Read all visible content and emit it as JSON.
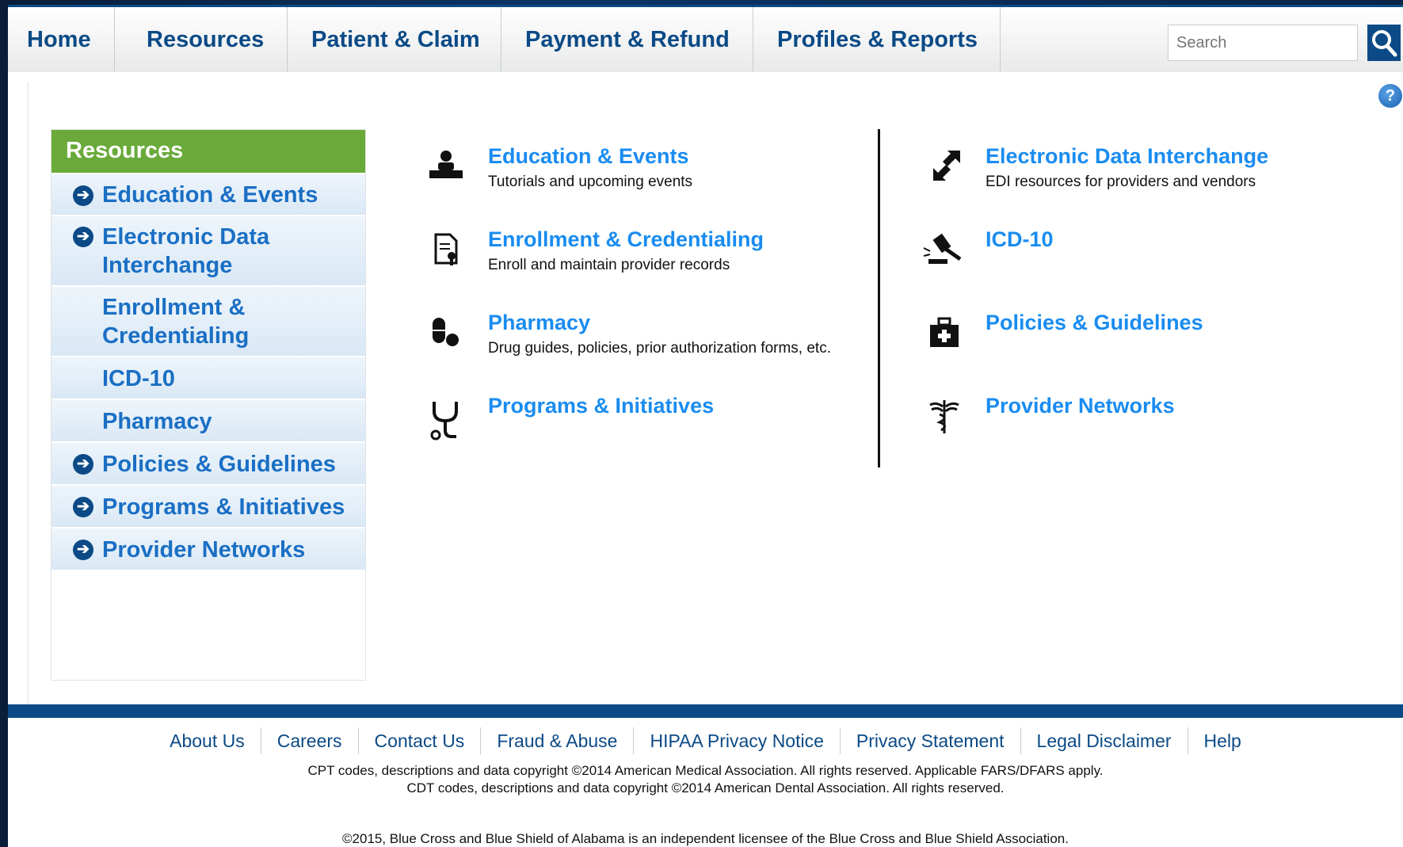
{
  "nav": {
    "items": [
      "Home",
      "Resources",
      "Patient & Claim",
      "Payment & Refund",
      "Profiles & Reports"
    ],
    "search_placeholder": "Search"
  },
  "sidebar": {
    "title": "Resources",
    "items": [
      {
        "label": "Education & Events",
        "arrow": true
      },
      {
        "label": "Electronic Data Interchange",
        "arrow": true
      },
      {
        "label": "Enrollment & Credentialing",
        "arrow": false
      },
      {
        "label": "ICD-10",
        "arrow": false
      },
      {
        "label": "Pharmacy",
        "arrow": false
      },
      {
        "label": "Policies & Guidelines",
        "arrow": true
      },
      {
        "label": "Programs & Initiatives",
        "arrow": true
      },
      {
        "label": "Provider Networks",
        "arrow": true
      }
    ]
  },
  "resources": {
    "left": [
      {
        "title": "Education & Events",
        "desc": "Tutorials and upcoming events",
        "icon": "teacher-icon"
      },
      {
        "title": "Enrollment & Credentialing",
        "desc": "Enroll and maintain provider records",
        "icon": "certificate-icon"
      },
      {
        "title": "Pharmacy",
        "desc": "Drug guides, policies, prior authorization forms, etc.",
        "icon": "pills-icon"
      },
      {
        "title": "Programs & Initiatives",
        "desc": "",
        "icon": "stethoscope-icon"
      }
    ],
    "right": [
      {
        "title": "Electronic Data Interchange",
        "desc": "EDI resources for providers and vendors",
        "icon": "exchange-arrows-icon"
      },
      {
        "title": "ICD-10",
        "desc": "",
        "icon": "gavel-icon"
      },
      {
        "title": "Policies & Guidelines",
        "desc": "",
        "icon": "medical-kit-icon"
      },
      {
        "title": "Provider Networks",
        "desc": "",
        "icon": "caduceus-icon"
      }
    ]
  },
  "footer": {
    "links": [
      "About Us",
      "Careers",
      "Contact Us",
      "Fraud & Abuse",
      "HIPAA Privacy Notice",
      "Privacy Statement",
      "Legal Disclaimer",
      "Help"
    ],
    "cpt_notice": "CPT codes, descriptions and data copyright ©2014 American Medical Association. All rights reserved. Applicable FARS/DFARS apply.",
    "cdt_notice": "CDT codes, descriptions and data copyright ©2014 American Dental Association. All rights reserved.",
    "copyright": "©2015, Blue Cross and Blue Shield of Alabama is an independent licensee of the Blue Cross and Blue Shield Association."
  },
  "colors": {
    "brand_blue": "#0b4a86",
    "link_blue": "#1a8cf0",
    "sidebar_green": "#6aaa3a"
  }
}
